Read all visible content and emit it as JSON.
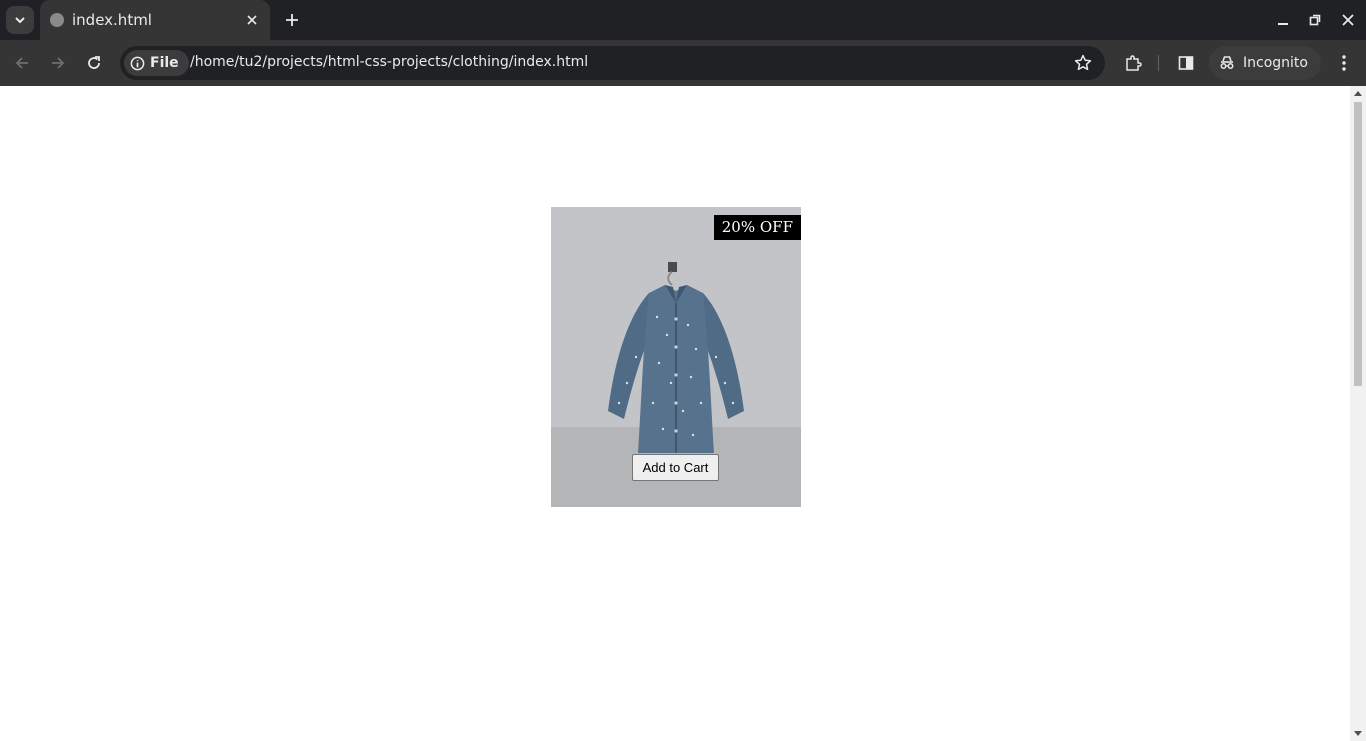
{
  "browser": {
    "tab": {
      "title": "index.html"
    },
    "chip_label": "File",
    "url": "/home/tu2/projects/html-css-projects/clothing/index.html",
    "incognito_label": "Incognito",
    "icons": [
      "tab-search-icon",
      "globe-icon",
      "close-icon",
      "plus-icon",
      "minimize-icon",
      "restore-icon",
      "window-close-icon",
      "back-icon",
      "forward-icon",
      "reload-icon",
      "info-icon",
      "star-icon",
      "extensions-icon",
      "side-panel-icon",
      "incognito-icon",
      "menu-icon"
    ]
  },
  "product": {
    "badge": "20% OFF",
    "cart_button": "Add to Cart",
    "colors": {
      "card_bg": "#c3c4c7",
      "floor": "#b4b5b7",
      "shirt": "#4f6b86",
      "badge_bg": "#000000"
    }
  }
}
